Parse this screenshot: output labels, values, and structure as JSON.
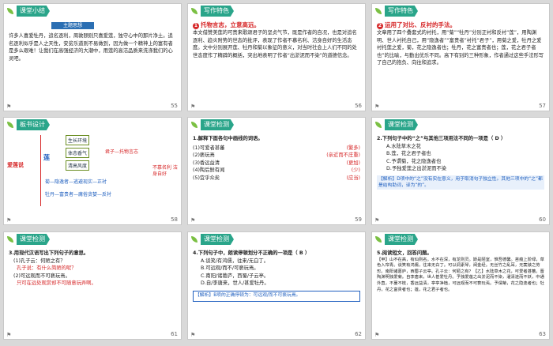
{
  "slides": [
    {
      "id": 55,
      "tab": "课堂小结",
      "ribbon": "主题思想",
      "text": "许多人喜爱牡丹，追名逐利，周敦颐则只喜爱莲，独守心中的那片净土。追名逐利似乎是人之天性，安贫乐道则不易做到，因为做一个精神上的富有者是多么艰难！让我们在高强经济的大潮中，用莲的高洁品质来洗涤我们的心灵吧。",
      "num": "55"
    },
    {
      "id": 56,
      "tab": "写作特色",
      "heading": "托物言志，立意高远。",
      "text": "本文借赞美莲的可贵来歌颂君子的坚贞气节，既是作者的自况，也是对追名逐利、趋炎附势的世态的批评，表现了作者不慕名利、洁身自好的生活态度。文中分别展开莲、牡丹和菊以象征的意义，对当时社会上人们不同的处世态度作了精辟的概括，突出地表明了作者“出淤泥而不染”的道德信念。",
      "num": "56"
    },
    {
      "id": 57,
      "tab": "写作特色",
      "heading": "运用了对比、反衬的手法。",
      "text": "文章用了四个叠套式的衬托，用“菊”“牡丹”分别正衬和反衬“莲”，用陶渊明、世人衬托自己，用“隐逸者”“富贵者”衬托“君子”，用菊之爱，牡丹之爱衬托莲之爱，菊，花之隐逸者也；牡丹，花之富贵者也；莲，花之君子者也”的比喻，与勤出优乐不同。高下有别的三种形象，作者通过这些手法形写了自己的抱负、向往和追求。",
      "num": "57"
    },
    {
      "id": 58,
      "tab": "板书设计",
      "title": "爱莲说",
      "items": [
        "生长环境",
        "体态香气",
        "清高风度",
        "菊—隐逸者—逃避现实—正衬",
        "牡丹—富贵者—庸俗贪婪—反衬"
      ],
      "center": "君子—托物言志",
      "right": "不慕名利 洁身自好",
      "lotus": "莲",
      "num": "58"
    },
    {
      "id": 59,
      "tab": "课堂检测",
      "q": "1.解释下面各句中画线的词语。",
      "lines": [
        "(1)可爱者甚蕃",
        "(2)亵玩焉",
        "(3)香远益清",
        "(4)陶后鲜有闻",
        "(5)宜乎众矣"
      ],
      "answers": [
        "(繁多)",
        "(亲近而不庄重)",
        "(更加)",
        "(少)",
        "(应当)"
      ],
      "num": "59"
    },
    {
      "id": 60,
      "tab": "课堂检测",
      "q": "2.下列句子中的“之”与其他三项用法不同的一项是（ D ）",
      "opts": [
        "A.水陆草木之花",
        "B.莲，花之君子者也",
        "C.予谓菊，花之隐逸者也",
        "D.予独爱莲之出淤泥而不染"
      ],
      "analysis": "【解析】D项中的“之”没有实在意义，用于取消句子独立性。其他三项中的“之”都是结构助词，译为“的”。",
      "num": "60"
    },
    {
      "id": 61,
      "tab": "课堂检测",
      "q": "3.用现代汉语写出下列句子的意思。",
      "items": [
        "(1)孔子云：何陋之有？",
        "孔子说：有什么简陋的呢？",
        "(2)可远观而不可亵玩焉。",
        "只可在远处观赏却不可随意玩弄啊。"
      ],
      "num": "61"
    },
    {
      "id": 62,
      "tab": "课堂检测",
      "q": "4.下列句子中，朗读停顿划分不正确的一项是（ B ）",
      "opts": [
        "A.谈笑/有鸿儒，往来/无白丁。",
        "B.可远观/而不/可亵玩焉。",
        "C.南阳/诸葛庐，西蜀/子云亭。",
        "D.自/李唐来，世人/甚爱牡丹。"
      ],
      "analysis": "【解析】B项的正确停顿为：可远观/而不可亵玩焉。",
      "num": "62"
    },
    {
      "id": 63,
      "tab": "课堂检测",
      "q": "5.阅读短文，回答问题。",
      "text": "【甲】山不在高，有仙则名。水不在深，有龙则灵。斯是陋室，惟吾德馨。苔痕上阶绿，草色入帘青。谈笑有鸿儒，往来无白丁。可以调素琴，阅金经。无丝竹之乱耳，无案牍之劳形。南阳诸葛庐，西蜀子云亭。孔子云：何陋之有？【乙】水陆草木之花，可爱者甚蕃。晋陶渊明独爱菊。自李唐来，世人甚爱牡丹。予独爱莲之出淤泥而不染，濯清涟而不妖，中通外直，不蔓不枝，香远益清，亭亭净植，可远观而不可亵玩焉。予谓菊，花之隐逸者也；牡丹，花之富贵者也；莲，花之君子者也。",
      "num": "63"
    }
  ]
}
